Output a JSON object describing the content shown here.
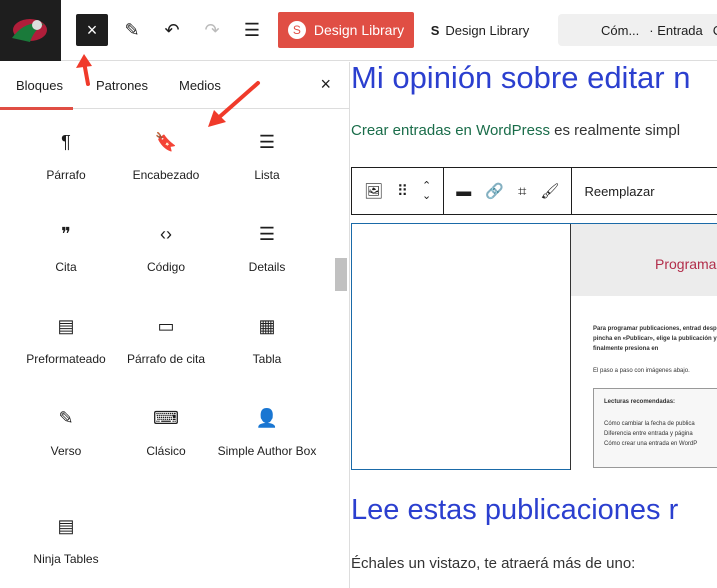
{
  "topbar": {
    "close_icon": "×",
    "design_library_button": "Design Library",
    "design_library_link": "Design Library",
    "doc_title": "Cóm...",
    "doc_type": "· Entrada",
    "doc_extra": "C"
  },
  "inserter": {
    "tabs": [
      "Bloques",
      "Patrones",
      "Medios"
    ],
    "close": "×",
    "blocks": [
      {
        "label": "Párrafo",
        "icon": "¶"
      },
      {
        "label": "Encabezado",
        "icon": "🔖"
      },
      {
        "label": "Lista",
        "icon": "☰"
      },
      {
        "label": "Cita",
        "icon": "❞"
      },
      {
        "label": "Código",
        "icon": "‹›"
      },
      {
        "label": "Details",
        "icon": "☰"
      },
      {
        "label": "Preformateado",
        "icon": "▤"
      },
      {
        "label": "Párrafo de cita",
        "icon": "▭"
      },
      {
        "label": "Tabla",
        "icon": "▦"
      },
      {
        "label": "Verso",
        "icon": "✎"
      },
      {
        "label": "Clásico",
        "icon": "⌨"
      },
      {
        "label": "Simple Author Box",
        "icon": "👤"
      },
      {
        "label": "Ninja Tables",
        "icon": "▤"
      }
    ]
  },
  "editor": {
    "heading": "Mi opinión sobre editar n",
    "link": "Crear entradas en WordPress",
    "para_rest": " es realmente simpl",
    "toolbar_replace": "Reemplazar",
    "shot": {
      "title": "Programa",
      "text": "Para programar publicaciones, entrad después pincha en «Publicar», elige la publicación y finalmente presiona en",
      "steps": "El paso a paso con imágenes abajo.",
      "box_title": "Lecturas recomendadas:",
      "links": [
        "Cómo cambiar la fecha de publica",
        "Diferencia entre entrada y página",
        "Cómo crear una entrada en WordP"
      ]
    },
    "heading2": "Lee estas publicaciones r",
    "para2": "Échales un vistazo, te atraerá más de uno:"
  },
  "colors": {
    "accent": "#e04e44",
    "heading": "#2b3fcf",
    "link": "#1a6d4a"
  }
}
